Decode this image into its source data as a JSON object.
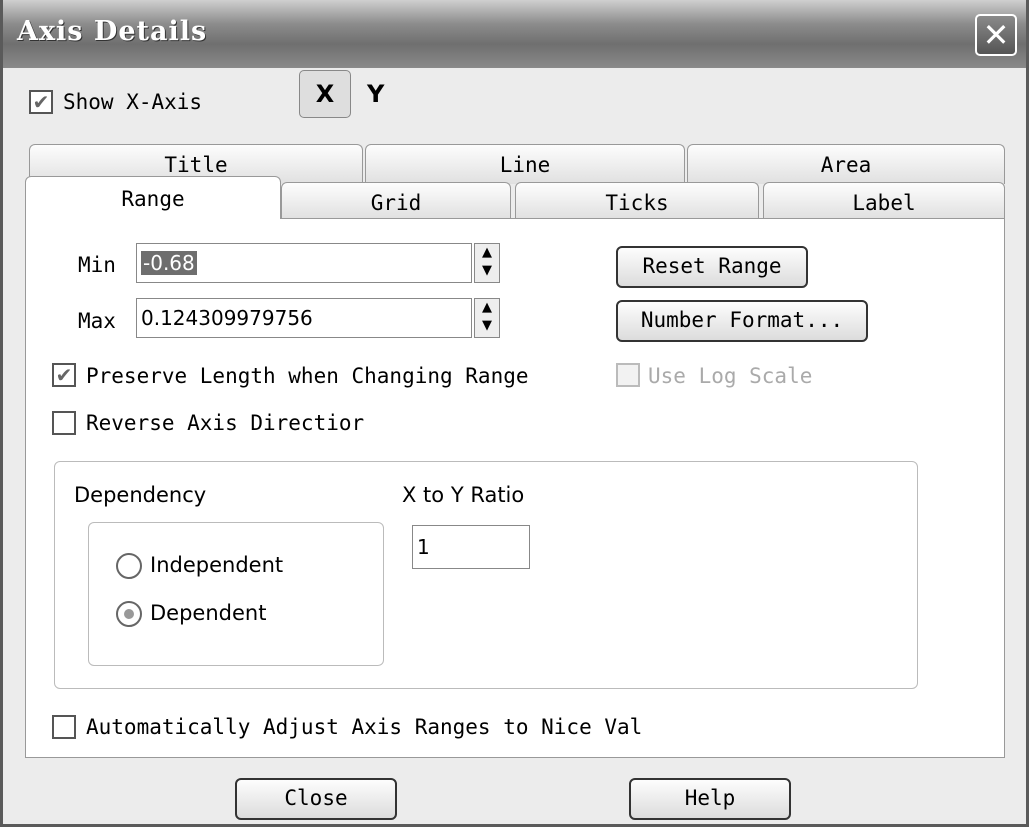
{
  "window": {
    "title": "Axis Details",
    "close_glyph": "✕"
  },
  "show_axis": {
    "label": "Show X-Axis",
    "checked": true
  },
  "axis_selector": {
    "x": "X",
    "y": "Y",
    "selected": "X"
  },
  "tabs_back": [
    "Title",
    "Line",
    "Area"
  ],
  "tabs_front": [
    "Range",
    "Grid",
    "Ticks",
    "Label"
  ],
  "active_tab": "Range",
  "range": {
    "min_label": "Min",
    "min_value": "-0.68",
    "max_label": "Max",
    "max_value": "0.124309979756",
    "reset_button": "Reset Range",
    "number_format_button": "Number Format...",
    "preserve_label": "Preserve Length when Changing Range",
    "preserve_checked": true,
    "log_scale_label": "Use Log Scale",
    "log_scale_enabled": false,
    "reverse_label": "Reverse Axis Directior",
    "reverse_checked": false
  },
  "dependency": {
    "group_label": "Dependency",
    "independent_label": "Independent",
    "dependent_label": "Dependent",
    "selected": "Dependent",
    "ratio_label": "X to Y Ratio",
    "ratio_value": "1"
  },
  "auto_adjust": {
    "label": "Automatically Adjust Axis Ranges to Nice Val",
    "checked": false
  },
  "footer": {
    "close_button": "Close",
    "help_button": "Help"
  },
  "icons": {
    "check": "✔",
    "spin_up": "▲",
    "spin_down": "▼"
  }
}
